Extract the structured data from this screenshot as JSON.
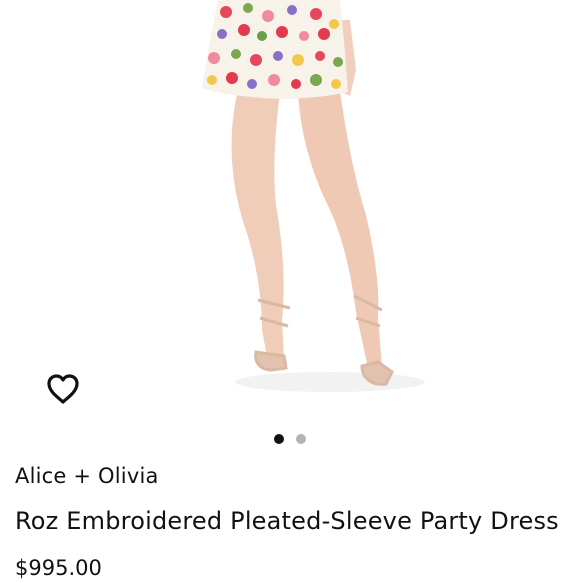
{
  "product": {
    "brand": "Alice + Olivia",
    "title": "Roz Embroidered Pleated-Sleeve Party Dress",
    "price": "$995.00"
  },
  "gallery": {
    "total_images": 2,
    "active_index": 0,
    "active_dot_color": "#111111",
    "inactive_dot_color": "#b3b3b3"
  },
  "icons": {
    "favorite": "heart-outline-icon"
  }
}
